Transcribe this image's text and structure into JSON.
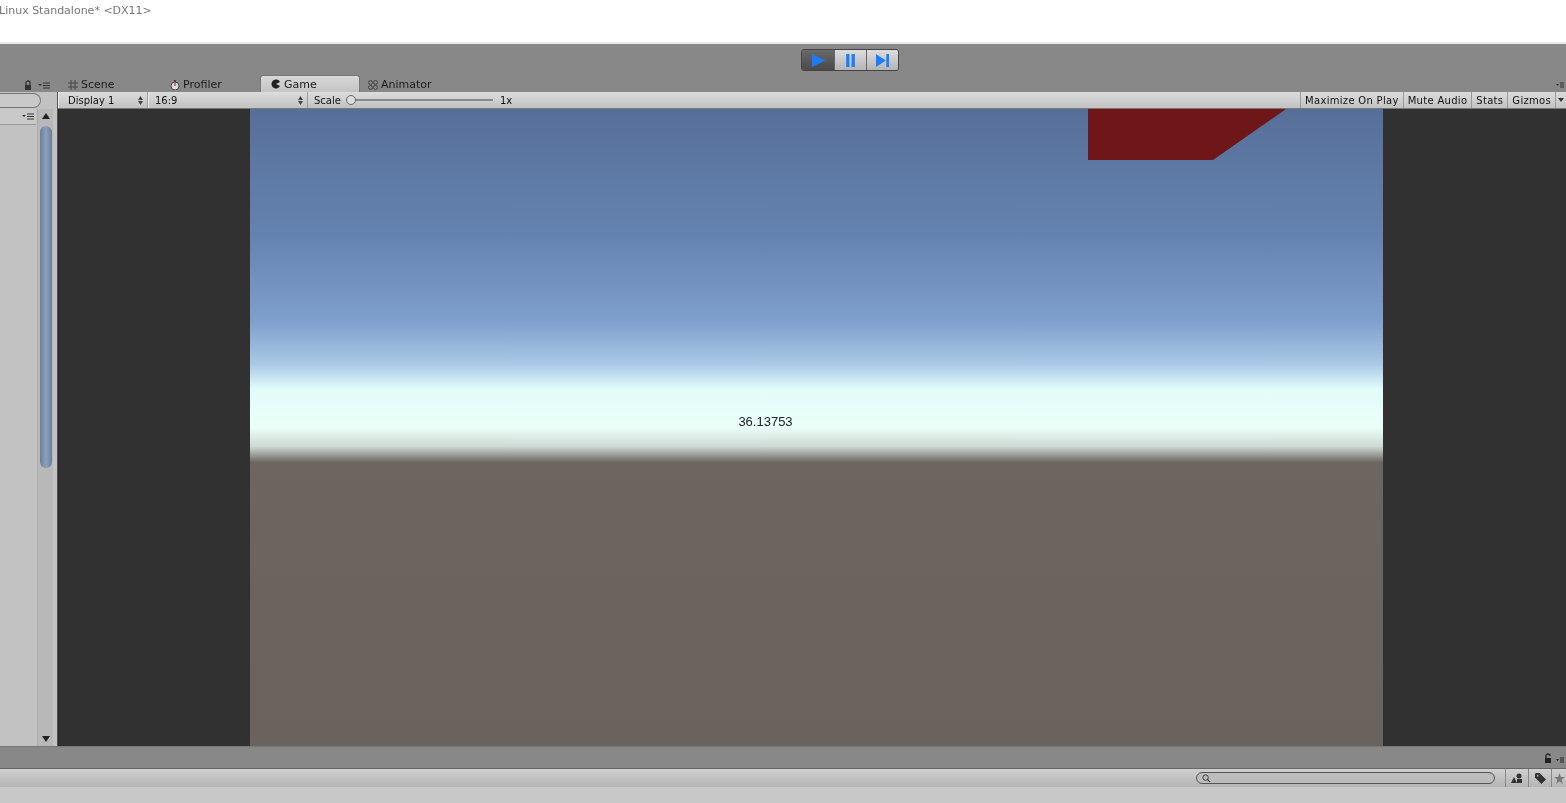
{
  "window": {
    "title": "Linux Standalone* <DX11>"
  },
  "play_controls": [
    {
      "kind": "play",
      "selected": true
    },
    {
      "kind": "pause",
      "selected": false
    },
    {
      "kind": "step",
      "selected": false
    }
  ],
  "tabs": [
    {
      "label": "Scene",
      "kind": "scene",
      "selected": false
    },
    {
      "label": "Profiler",
      "kind": "profiler",
      "selected": false
    },
    {
      "label": "Game",
      "kind": "game",
      "selected": true
    },
    {
      "label": "Animator",
      "kind": "animator",
      "selected": false
    }
  ],
  "game_toolbar": {
    "display": "Display 1",
    "aspect": "16:9",
    "scale_label": "Scale",
    "scale": {
      "level": 0,
      "reading": "1x"
    },
    "buttons": [
      "Maximize On Play",
      "Mute Audio",
      "Stats",
      "Gizmos"
    ]
  },
  "game_view": {
    "text": "36.13753"
  }
}
